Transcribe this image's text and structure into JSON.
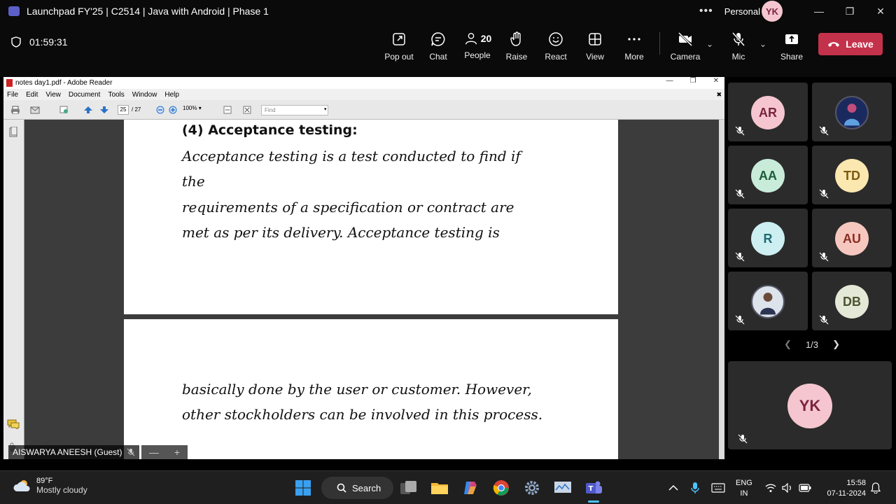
{
  "window": {
    "title": "Launchpad FY'25 | C2514 | Java with Android | Phase 1",
    "personal_label": "Personal",
    "user_initials": "YK"
  },
  "meeting": {
    "timer": "01:59:31",
    "people_count": "20",
    "buttons": {
      "popout": "Pop out",
      "chat": "Chat",
      "people": "People",
      "raise": "Raise",
      "react": "React",
      "view": "View",
      "more": "More",
      "camera": "Camera",
      "mic": "Mic",
      "share": "Share",
      "leave": "Leave"
    }
  },
  "reader": {
    "window_title": "notes day1.pdf - Adobe Reader",
    "menu": [
      "File",
      "Edit",
      "View",
      "Document",
      "Tools",
      "Window",
      "Help"
    ],
    "page_current": "25",
    "page_total": "/ 27",
    "zoom": "100%",
    "find_placeholder": "Find",
    "page1_lines": [
      "(4) Acceptance testing:",
      "Acceptance testing is a test conducted to find if",
      "the",
      "requirements of a specification or contract are",
      "met as per its delivery. Acceptance testing is"
    ],
    "page2_lines": [
      "basically done by the user or customer. However,",
      "other stockholders can be involved in this process."
    ]
  },
  "presenter_tag": "AISWARYA ANEESH (Guest)",
  "participants": [
    {
      "initials": "AR",
      "bg": "#f5c6cf",
      "fg": "#7a2440"
    },
    {
      "initials": "",
      "bg": "#1b2a5e",
      "fg": "#ffffff"
    },
    {
      "initials": "AA",
      "bg": "#c8ecd9",
      "fg": "#1d5b3a"
    },
    {
      "initials": "TD",
      "bg": "#fbe7b0",
      "fg": "#7a5a10"
    },
    {
      "initials": "R",
      "bg": "#cdeff2",
      "fg": "#1e6b74"
    },
    {
      "initials": "AU",
      "bg": "#f6c7bf",
      "fg": "#8a2f22"
    },
    {
      "initials": "",
      "bg": "#dde3ea",
      "fg": "#333333"
    },
    {
      "initials": "DB",
      "bg": "#e4e8d6",
      "fg": "#4a5230"
    }
  ],
  "pager": "1/3",
  "self_tile": {
    "initials": "YK"
  },
  "taskbar": {
    "temperature": "89°F",
    "weather": "Mostly cloudy",
    "search": "Search",
    "lang1": "ENG",
    "lang2": "IN",
    "time": "15:58",
    "date": "07-11-2024"
  }
}
